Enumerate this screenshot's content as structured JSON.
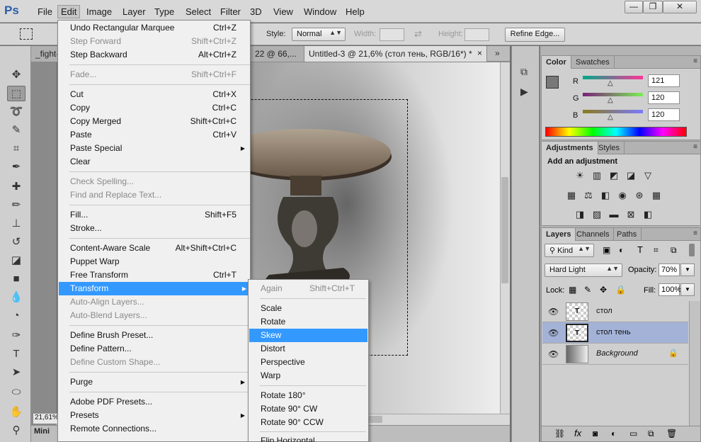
{
  "app": {
    "logo": "Ps"
  },
  "menubar": {
    "items": [
      "File",
      "Edit",
      "Image",
      "Layer",
      "Type",
      "Select",
      "Filter",
      "3D",
      "View",
      "Window",
      "Help"
    ],
    "window_buttons": {
      "minimize": "—",
      "restore": "❐",
      "close": "✕"
    }
  },
  "options": {
    "style_label": "Style:",
    "style_value": "Normal",
    "width_label": "Width:",
    "height_label": "Height:",
    "refine_edge": "Refine Edge..."
  },
  "tabs": {
    "tab1": "_fight-",
    "tab2": "22 @ 66,...",
    "tab3": "Untitled-3 @ 21,6% (стол тень, RGB/16*) *",
    "close": "×",
    "overflow": "»"
  },
  "status": {
    "zoom": "21,61%",
    "mini": "Mini"
  },
  "color_panel": {
    "tabs": [
      "Color",
      "Swatches"
    ],
    "r_label": "R",
    "g_label": "G",
    "b_label": "B",
    "r": "121",
    "g": "120",
    "b": "120"
  },
  "adjustments_panel": {
    "tabs": [
      "Adjustments",
      "Styles"
    ],
    "heading": "Add an adjustment"
  },
  "layers_panel": {
    "tabs": [
      "Layers",
      "Channels",
      "Paths"
    ],
    "kind_label": "Kind",
    "blend_mode": "Hard Light",
    "opacity_label": "Opacity:",
    "opacity_value": "70%",
    "lock_label": "Lock:",
    "fill_label": "Fill:",
    "fill_value": "100%",
    "layers": [
      {
        "name": "стол",
        "selected": false
      },
      {
        "name": "стол тень",
        "selected": true
      },
      {
        "name": "Background",
        "selected": false
      }
    ]
  },
  "edit_menu": {
    "items": [
      {
        "label": "Undo Rectangular Marquee",
        "shortcut": "Ctrl+Z"
      },
      {
        "label": "Step Forward",
        "shortcut": "Shift+Ctrl+Z"
      },
      {
        "label": "Step Backward",
        "shortcut": "Alt+Ctrl+Z"
      },
      {
        "label": "Fade...",
        "shortcut": "Shift+Ctrl+F"
      },
      {
        "label": "Cut",
        "shortcut": "Ctrl+X"
      },
      {
        "label": "Copy",
        "shortcut": "Ctrl+C"
      },
      {
        "label": "Copy Merged",
        "shortcut": "Shift+Ctrl+C"
      },
      {
        "label": "Paste",
        "shortcut": "Ctrl+V"
      },
      {
        "label": "Paste Special",
        "shortcut": ""
      },
      {
        "label": "Clear",
        "shortcut": ""
      },
      {
        "label": "Check Spelling...",
        "shortcut": ""
      },
      {
        "label": "Find and Replace Text...",
        "shortcut": ""
      },
      {
        "label": "Fill...",
        "shortcut": "Shift+F5"
      },
      {
        "label": "Stroke...",
        "shortcut": ""
      },
      {
        "label": "Content-Aware Scale",
        "shortcut": "Alt+Shift+Ctrl+C"
      },
      {
        "label": "Puppet Warp",
        "shortcut": ""
      },
      {
        "label": "Free Transform",
        "shortcut": "Ctrl+T"
      },
      {
        "label": "Transform",
        "shortcut": ""
      },
      {
        "label": "Auto-Align Layers...",
        "shortcut": ""
      },
      {
        "label": "Auto-Blend Layers...",
        "shortcut": ""
      },
      {
        "label": "Define Brush Preset...",
        "shortcut": ""
      },
      {
        "label": "Define Pattern...",
        "shortcut": ""
      },
      {
        "label": "Define Custom Shape...",
        "shortcut": ""
      },
      {
        "label": "Purge",
        "shortcut": ""
      },
      {
        "label": "Adobe PDF Presets...",
        "shortcut": ""
      },
      {
        "label": "Presets",
        "shortcut": ""
      },
      {
        "label": "Remote Connections...",
        "shortcut": ""
      }
    ]
  },
  "transform_menu": {
    "items": [
      {
        "label": "Again",
        "shortcut": "Shift+Ctrl+T"
      },
      {
        "label": "Scale",
        "shortcut": ""
      },
      {
        "label": "Rotate",
        "shortcut": ""
      },
      {
        "label": "Skew",
        "shortcut": ""
      },
      {
        "label": "Distort",
        "shortcut": ""
      },
      {
        "label": "Perspective",
        "shortcut": ""
      },
      {
        "label": "Warp",
        "shortcut": ""
      },
      {
        "label": "Rotate 180°",
        "shortcut": ""
      },
      {
        "label": "Rotate 90° CW",
        "shortcut": ""
      },
      {
        "label": "Rotate 90° CCW",
        "shortcut": ""
      },
      {
        "label": "Flip Horizontal",
        "shortcut": ""
      }
    ]
  }
}
